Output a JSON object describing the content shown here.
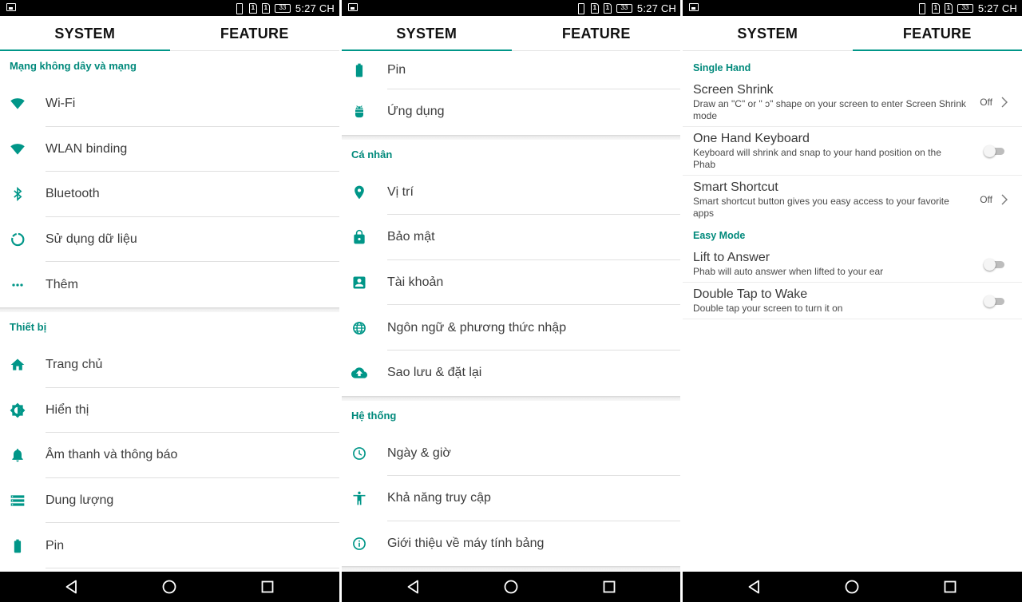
{
  "status_bar": {
    "time": "5:27 CH",
    "sim1": "1",
    "sim2": "1",
    "battery": "33"
  },
  "tabs": {
    "system": "SYSTEM",
    "feature": "FEATURE"
  },
  "colors": {
    "accent": "#009688",
    "section": "#00897b",
    "bars": "#000000"
  },
  "screen1": {
    "sections": [
      {
        "title": "Mạng không dây và mạng",
        "items": [
          {
            "icon": "wifi-icon",
            "label": "Wi-Fi"
          },
          {
            "icon": "wifi-icon",
            "label": "WLAN binding"
          },
          {
            "icon": "bluetooth-icon",
            "label": "Bluetooth"
          },
          {
            "icon": "data-usage-icon",
            "label": "Sử dụng dữ liệu"
          },
          {
            "icon": "more-icon",
            "label": "Thêm"
          }
        ]
      },
      {
        "title": "Thiết bị",
        "items": [
          {
            "icon": "home-icon",
            "label": "Trang chủ"
          },
          {
            "icon": "brightness-icon",
            "label": "Hiển thị"
          },
          {
            "icon": "bell-icon",
            "label": "Âm thanh và thông báo"
          },
          {
            "icon": "storage-icon",
            "label": "Dung lượng"
          },
          {
            "icon": "battery-icon",
            "label": "Pin"
          }
        ]
      }
    ]
  },
  "screen2": {
    "top_items": [
      {
        "icon": "battery-icon",
        "label": "Pin"
      },
      {
        "icon": "android-icon",
        "label": "Ứng dụng"
      }
    ],
    "sections": [
      {
        "title": "Cá nhân",
        "items": [
          {
            "icon": "location-icon",
            "label": "Vị trí"
          },
          {
            "icon": "lock-icon",
            "label": "Bảo mật"
          },
          {
            "icon": "account-icon",
            "label": "Tài khoản"
          },
          {
            "icon": "globe-icon",
            "label": "Ngôn ngữ & phương thức nhập"
          },
          {
            "icon": "cloud-upload-icon",
            "label": "Sao lưu & đặt lại"
          }
        ]
      },
      {
        "title": "Hệ thống",
        "items": [
          {
            "icon": "clock-icon",
            "label": "Ngày & giờ"
          },
          {
            "icon": "accessibility-icon",
            "label": "Khả năng truy cập"
          },
          {
            "icon": "info-icon",
            "label": "Giới thiệu về máy tính bảng"
          }
        ]
      }
    ]
  },
  "screen3": {
    "single_hand": {
      "title": "Single Hand",
      "screen_shrink": {
        "title": "Screen Shrink",
        "desc": "Draw an \"C\" or \" ɔ\" shape on your screen to enter Screen Shrink mode",
        "value": "Off"
      },
      "one_hand_keyboard": {
        "title": "One Hand Keyboard",
        "desc": "Keyboard will shrink and snap to your hand position on the Phab",
        "enabled": false
      },
      "smart_shortcut": {
        "title": "Smart Shortcut",
        "desc": "Smart shortcut button gives you easy access to your favorite apps",
        "value": "Off"
      }
    },
    "easy_mode": {
      "title": "Easy Mode",
      "lift_to_answer": {
        "title": "Lift to Answer",
        "desc": "Phab will auto answer when lifted to your ear",
        "enabled": false
      },
      "double_tap": {
        "title": "Double Tap to Wake",
        "desc": "Double tap your screen to turn it on",
        "enabled": false
      }
    }
  }
}
